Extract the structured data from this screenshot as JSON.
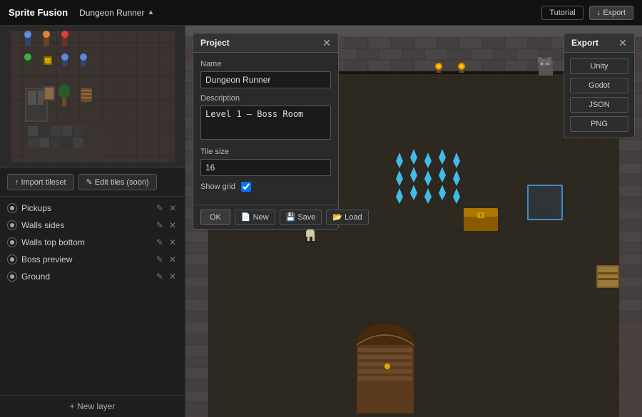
{
  "app": {
    "title": "Sprite Fusion"
  },
  "header": {
    "project_name": "Dungeon Runner",
    "project_arrow": "▲",
    "tutorial_label": "Tutorial",
    "export_label": "↓ Export"
  },
  "left_panel": {
    "import_btn": "↑ Import tileset",
    "edit_btn": "✎ Edit tiles (soon)",
    "layers": [
      {
        "name": "Pickups",
        "visible": true
      },
      {
        "name": "Walls sides",
        "visible": true
      },
      {
        "name": "Walls top bottom",
        "visible": true
      },
      {
        "name": "Boss preview",
        "visible": true
      },
      {
        "name": "Ground",
        "visible": true
      }
    ],
    "new_layer_btn": "+ New layer"
  },
  "dialog": {
    "title": "Project",
    "name_label": "Name",
    "name_value": "Dungeon Runner",
    "desc_label": "Description",
    "desc_value": "Level 1 – Boss Room",
    "tile_size_label": "Tile size",
    "tile_size_value": "16",
    "show_grid_label": "Show grid",
    "show_grid_checked": true,
    "ok_btn": "OK",
    "new_btn": "New",
    "save_btn": "Save",
    "load_btn": "Load"
  },
  "export_panel": {
    "title": "Export",
    "unity_btn": "Unity",
    "godot_btn": "Godot",
    "json_btn": "JSON",
    "png_btn": "PNG"
  }
}
